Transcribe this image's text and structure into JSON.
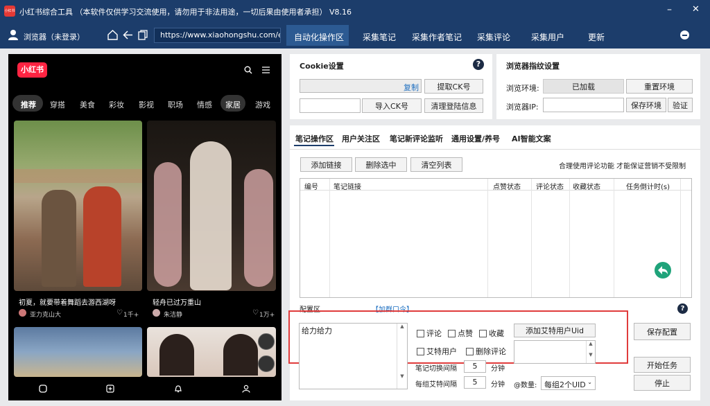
{
  "window": {
    "title": "小红书综合工具  （本软件仅供学习交流使用，请勿用于非法用途，一切后果由使用者承担）  V8.16",
    "logo": "小红书",
    "minimize": "–",
    "close": "✕"
  },
  "navbar": {
    "browser_label": "浏览器（未登录）",
    "url": "https://www.xiaohongshu.com/e",
    "tabs": [
      "自动化操作区",
      "采集笔记",
      "采集作者笔记",
      "采集评论",
      "采集用户",
      "更新"
    ]
  },
  "phone": {
    "logo": "小红书",
    "categories": [
      "推荐",
      "穿搭",
      "美食",
      "彩妆",
      "影视",
      "职场",
      "情感",
      "家居",
      "游戏"
    ],
    "cards": [
      {
        "title": "初夏，就要带着舞蹈去游西湖呀",
        "author": "亚力克山大",
        "likes": "1千+"
      },
      {
        "title": "轻舟已过万重山",
        "author": "朱洁静",
        "likes": "1万+"
      }
    ]
  },
  "cookie": {
    "title": "Cookie设置",
    "copy": "复制",
    "get_ck": "提取CK号",
    "import_ck": "导入CK号",
    "clear_login": "清理登陆信息"
  },
  "fingerprint": {
    "title": "浏览器指纹设置",
    "env_label": "浏览环境:",
    "env_value": "已加载",
    "reset_env": "重置环境",
    "ip_label": "浏览器IP:",
    "save_env": "保存环境",
    "verify": "验证"
  },
  "ops": {
    "tabs": [
      "笔记操作区",
      "用户关注区",
      "笔记新评论监听",
      "通用设置/养号",
      "AI智能文案"
    ],
    "add_link": "添加链接",
    "delete_selected": "删除选中",
    "clear_list": "清空列表",
    "notice": "合理使用评论功能 才能保证营销不受限制",
    "columns": [
      "编号",
      "笔记链接",
      "点赞状态",
      "评论状态",
      "收藏状态",
      "任务倒计时(s)"
    ]
  },
  "config": {
    "title": "配置区",
    "group_link": "【加群口令】",
    "comment_text": "给力给力",
    "chk_comment": "评论",
    "chk_like": "点赞",
    "chk_collect": "收藏",
    "chk_at": "艾特用户",
    "chk_delete": "删除评论",
    "add_uid": "添加艾特用户Uid",
    "switch_label": "笔记切换间隔",
    "switch_value": "5",
    "switch_unit": "分钟",
    "group_label": "每组艾特间隔",
    "group_value": "5",
    "group_unit": "分钟",
    "count_label": "@数量:",
    "count_value": "每组2个UID",
    "save": "保存配置",
    "start": "开始任务",
    "stop": "停止"
  }
}
